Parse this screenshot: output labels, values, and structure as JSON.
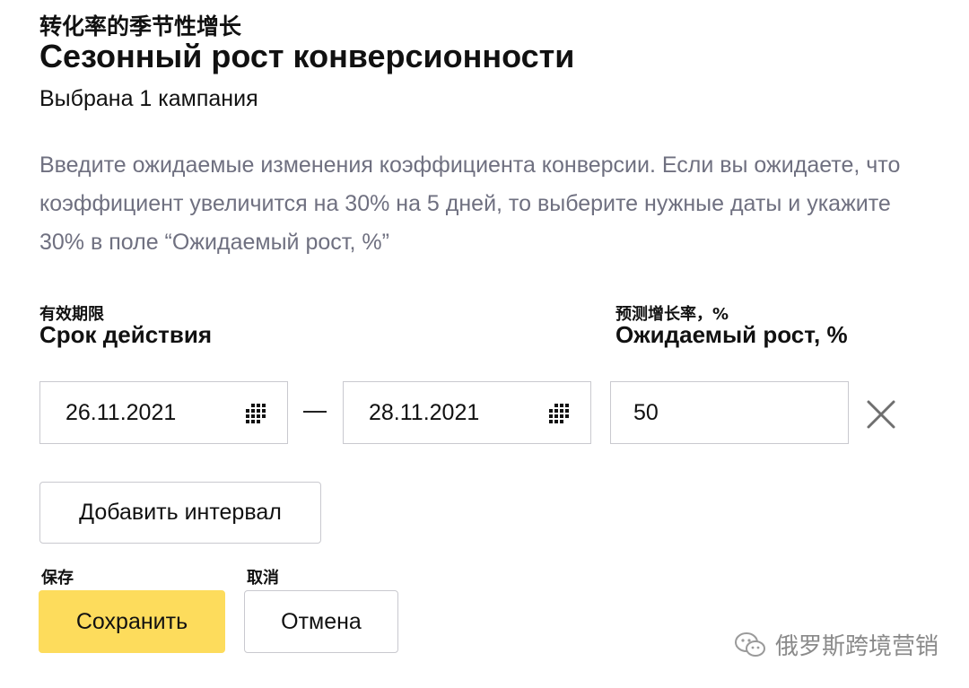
{
  "header": {
    "title_zh": "转化率的季节性增长",
    "title": "Сезонный рост конверсионности",
    "subtitle": "Выбрана 1 кампания"
  },
  "description": "Введите ожидаемые изменения коэффициента конверсии. Если вы ожидаете, что коэффициент увеличится на 30% на 5 дней, то выберите нужные даты и укажите 30% в поле “Ожидаемый рост, %”",
  "period": {
    "label_zh": "有效期限",
    "label": "Срок действия",
    "start_date": "26.11.2021",
    "end_date": "28.11.2021",
    "calendar_icon": "calendar-icon"
  },
  "growth": {
    "label_zh": "预测增长率，%",
    "label": "Ожидаемый рост, %",
    "value": "50"
  },
  "actions": {
    "add_interval": "Добавить интервал",
    "save_zh": "保存",
    "save": "Сохранить",
    "cancel_zh": "取消",
    "cancel": "Отмена"
  },
  "watermark": {
    "text": "俄罗斯跨境营销",
    "icon": "wechat-icon"
  },
  "colors": {
    "accent": "#fddc5c",
    "description_text": "#6f7080",
    "border": "#c9c9cf"
  }
}
